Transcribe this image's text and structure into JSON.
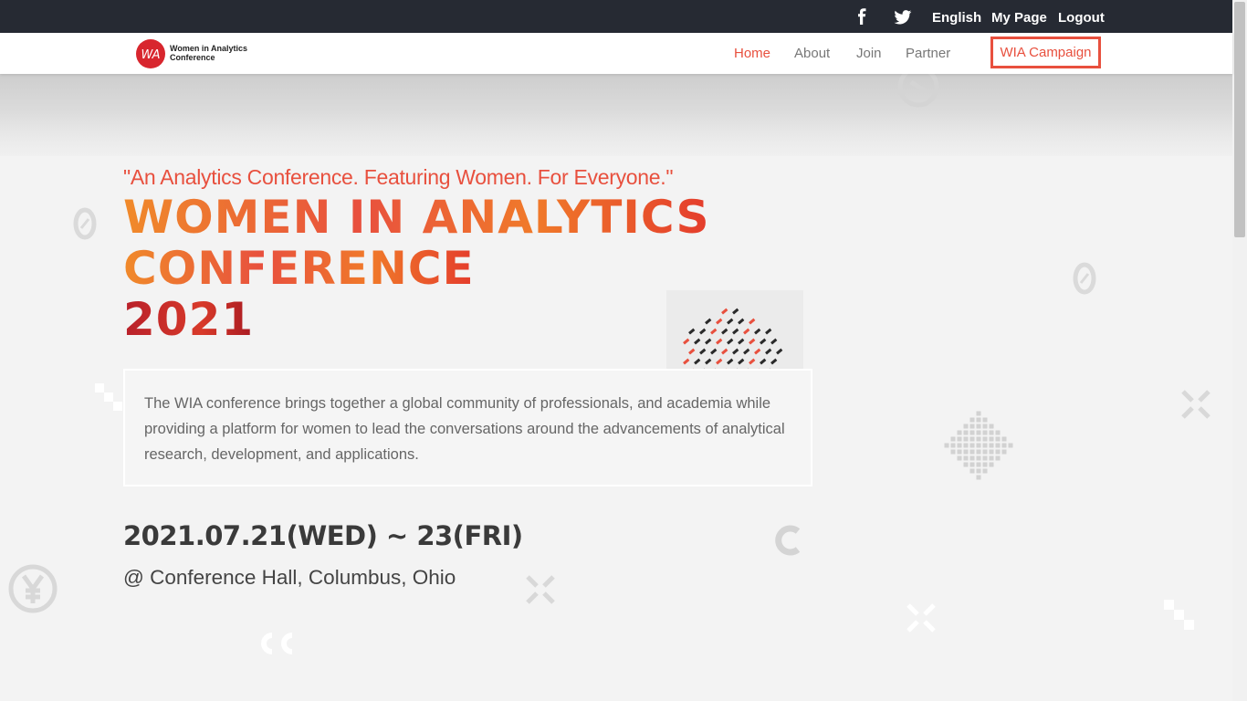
{
  "topbar": {
    "facebook_icon": "facebook-icon",
    "twitter_icon": "twitter-icon",
    "language": "English",
    "mypage": "My Page",
    "logout": "Logout"
  },
  "navbar": {
    "logo_initials": "WA",
    "logo_line1": "Women in Analytics",
    "logo_line2": "Conference",
    "items": [
      {
        "label": "Home",
        "active": true
      },
      {
        "label": "About"
      },
      {
        "label": "Join"
      },
      {
        "label": "Partner"
      }
    ],
    "campaign_label": "WIA Campaign"
  },
  "hero": {
    "tagline": "\"An Analytics Conference. Featuring Women. For Everyone.\"",
    "title_line1": "WOMEN IN ANALYTICS",
    "title_line2": "CONFERENCE",
    "title_line3": "2021",
    "description": "The WIA conference brings together a global community of professionals, and academia while providing a platform for women to lead the conversations around the advancements of analytical research, development, and applications.",
    "dates": "2021.07.21(WED) ~ 23(FRI)",
    "venue": "@ Conference Hall, Columbus, Ohio"
  },
  "colors": {
    "accent": "#e8503e",
    "topbar_bg": "#262a33",
    "page_bg": "#f3f3f3"
  }
}
